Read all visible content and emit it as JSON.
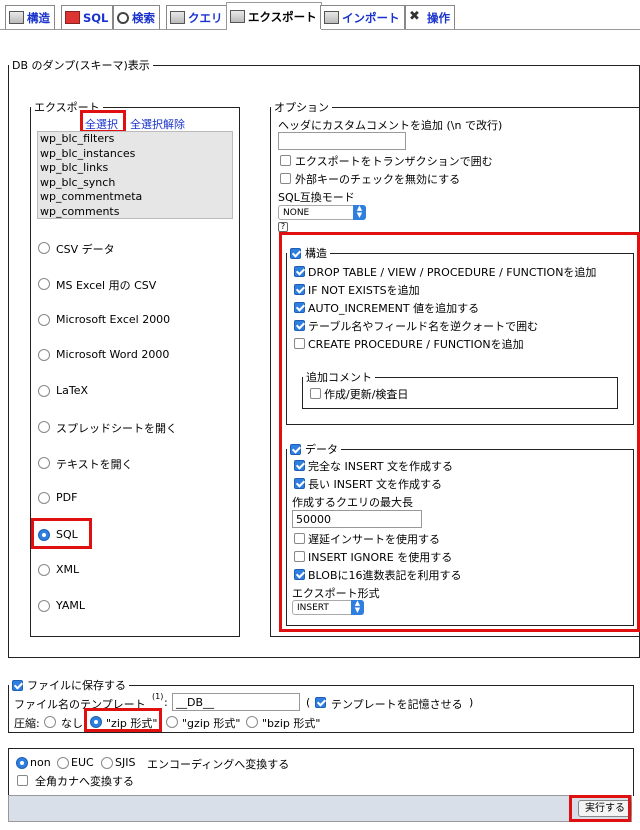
{
  "tabs": [
    {
      "label": "構造",
      "icon": "structure-icon"
    },
    {
      "label": "SQL",
      "icon": "sql-icon"
    },
    {
      "label": "検索",
      "icon": "search-icon"
    },
    {
      "label": "クエリ",
      "icon": "query-icon"
    },
    {
      "label": "エクスポート",
      "icon": "export-icon"
    },
    {
      "label": "インポート",
      "icon": "import-icon"
    },
    {
      "label": "操作",
      "icon": "operations-icon"
    }
  ],
  "dump": {
    "legend": "DB のダンプ(スキーマ)表示",
    "export": {
      "legend": "エクスポート",
      "select_all": "全選択",
      "deselect_all": "全選択解除",
      "tables": [
        "wp_blc_filters",
        "wp_blc_instances",
        "wp_blc_links",
        "wp_blc_synch",
        "wp_commentmeta",
        "wp_comments"
      ],
      "formats": [
        "CSV データ",
        "MS Excel 用の CSV",
        "Microsoft Excel 2000",
        "Microsoft Word 2000",
        "LaTeX",
        "スプレッドシートを開く",
        "テキストを開く",
        "PDF",
        "SQL",
        "XML",
        "YAML"
      ],
      "selected_format": "SQL"
    },
    "options": {
      "legend": "オプション",
      "header_comment_label": "ヘッダにカスタムコメントを追加 (\\n で改行)",
      "header_comment_value": "",
      "transaction_label": "エクスポートをトランザクションで囲む",
      "fk_label": "外部キーのチェックを無効にする",
      "compat_label": "SQL互換モード",
      "compat_value": "NONE",
      "help_icon": "?",
      "structure": {
        "legend": "構造",
        "items": [
          {
            "label": "DROP TABLE / VIEW / PROCEDURE / FUNCTIONを追加",
            "checked": true
          },
          {
            "label": "IF NOT EXISTSを追加",
            "checked": true
          },
          {
            "label": "AUTO_INCREMENT 値を追加する",
            "checked": true
          },
          {
            "label": "テーブル名やフィールド名を逆クォートで囲む",
            "checked": true
          },
          {
            "label": "CREATE PROCEDURE / FUNCTIONを追加",
            "checked": false
          }
        ],
        "comment_legend": "追加コメント",
        "comment_item": "作成/更新/検査日"
      },
      "data": {
        "legend": "データ",
        "complete_insert": "完全な INSERT 文を作成する",
        "extended_insert": "長い INSERT 文を作成する",
        "max_query_label": "作成するクエリの最大長",
        "max_query_value": "50000",
        "delayed_insert": "遅延インサートを使用する",
        "insert_ignore": "INSERT IGNORE を使用する",
        "blob_hex": "BLOBに16進数表記を利用する",
        "export_type_label": "エクスポート形式",
        "export_type_value": "INSERT"
      }
    }
  },
  "save": {
    "legend": "ファイルに保存する",
    "template_label": "ファイル名のテンプレート",
    "template_sup": "(1)",
    "template_colon": ":",
    "template_value": "__DB__",
    "remember_open": "(",
    "remember_label": "テンプレートを記憶させる",
    "remember_close": ")",
    "compress_label": "圧縮:",
    "compress_options": [
      "なし",
      "\"zip 形式\"",
      "\"gzip 形式\"",
      "\"bzip 形式\""
    ],
    "compress_selected": "\"zip 形式\""
  },
  "encoding": {
    "options": [
      "non",
      "EUC",
      "SJIS"
    ],
    "suffix": "エンコーディングへ変換する",
    "kana_label": "全角カナへ変換する"
  },
  "submit_label": "実行する",
  "colors": {
    "accent": "#2f7fe0",
    "highlight": "#e01010",
    "link": "#1a33cc",
    "footer_bar": "#d8dfe8"
  }
}
